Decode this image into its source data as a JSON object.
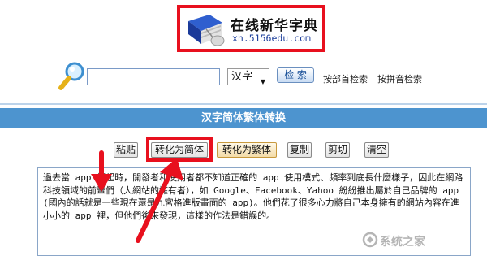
{
  "logo": {
    "title": "在线新华字典",
    "url": "xh.5156edu.com",
    "border_color": "#e8101e"
  },
  "search": {
    "input_value": "",
    "select_value": "汉字",
    "button_label": "检 索",
    "link_radical": "按部首检索",
    "link_pinyin": "按拼音检索"
  },
  "section": {
    "title": "汉字简体繁体转换",
    "header_color": "#4d94cf"
  },
  "toolbar": {
    "paste": "粘贴",
    "to_simplified": "转化为简体",
    "to_traditional": "转化为繁体",
    "copy": "复制",
    "cut": "剪切",
    "clear": "清空"
  },
  "editor": {
    "text": "過去當 app 崛起時，開發者和使用者都不知道正確的 app 使用模式、頻率到底長什麼樣子，因此在網路科技領域的前輩們（大網站的擁有者），如 Google、Facebook、Yahoo 紛紛推出屬於自己品牌的 app(國內的話就是一些現在還是九宮格進版畫面的 app)。他們花了很多心力將自己本身擁有的網站內容在進小小的 app 裡，但他們後來發現，這樣的作法是錯誤的。"
  },
  "annotations": {
    "arrow_color": "#e8101e"
  },
  "watermark": {
    "text": "系统之家"
  }
}
